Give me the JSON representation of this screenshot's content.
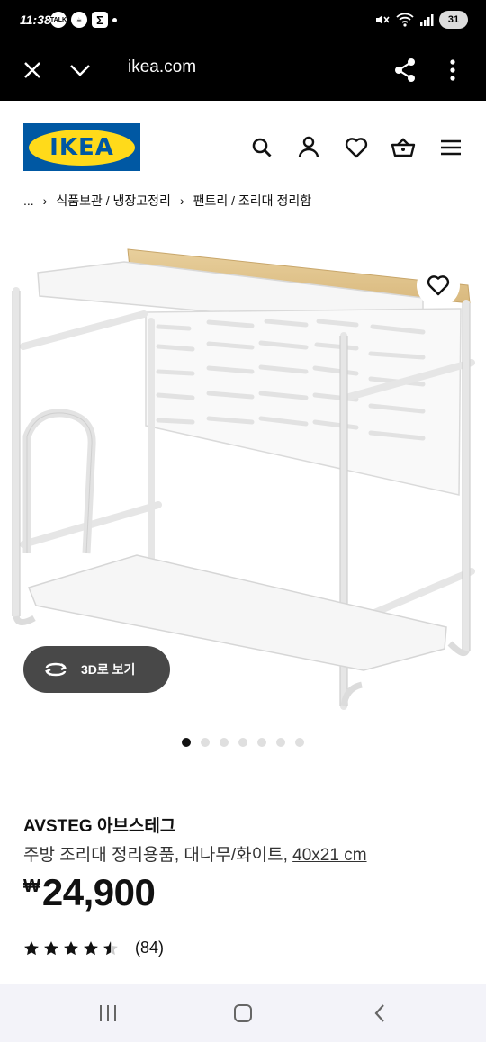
{
  "status_bar": {
    "time": "11:38",
    "notification_icons": [
      "talk-icon",
      "coffee-icon",
      "sigma-icon"
    ],
    "battery": "31"
  },
  "browser": {
    "url": "ikea.com"
  },
  "header": {
    "logo_text": "IKEA",
    "brand_blue": "#0058a3",
    "brand_yellow": "#ffda1a"
  },
  "breadcrumb": {
    "ellipsis": "...",
    "items": [
      "식품보관 / 냉장고정리",
      "팬트리 / 조리대 정리함"
    ]
  },
  "gallery": {
    "view_3d_label": "3D로 보기",
    "total_images": 7,
    "active_index": 0
  },
  "product": {
    "name": "AVSTEG 아브스테그",
    "description": "주방 조리대 정리용품, 대나무/화이트, ",
    "size": "40x21 cm",
    "currency": "₩",
    "price": "24,900",
    "rating_value": 4.5,
    "rating_max": 5,
    "review_count": "(84)"
  }
}
